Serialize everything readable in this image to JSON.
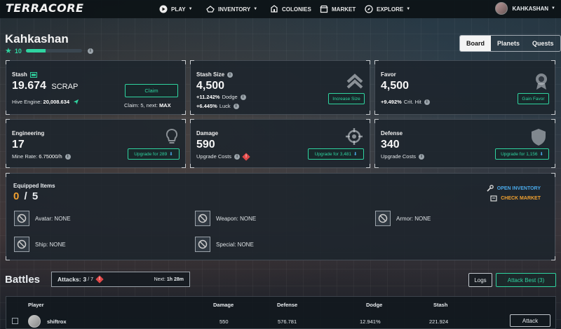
{
  "app": {
    "logo": "TERRACORE"
  },
  "nav": {
    "play": "PLAY",
    "inventory": "INVENTORY",
    "colonies": "COLONIES",
    "market": "MARKET",
    "explore": "EXPLORE",
    "username": "KAHKASHAN"
  },
  "profile": {
    "name": "Kahkashan",
    "level": "10",
    "xp_fraction": 0.35
  },
  "tabs": [
    "Board",
    "Planets",
    "Quests"
  ],
  "stash": {
    "title": "Stash",
    "value": "19.674",
    "unit": "SCRAP",
    "hive_label": "Hive Engine:",
    "hive_value": "20,008.634",
    "claim_button": "Claim",
    "claim_label": "Claim: 5, next:",
    "claim_next": "MAX"
  },
  "stash_size": {
    "title": "Stash Size",
    "value": "4,500",
    "dodge_pct": "+11.242%",
    "dodge_label": "Dodge",
    "luck_pct": "+6.445%",
    "luck_label": "Luck",
    "button": "Increase Size"
  },
  "favor": {
    "title": "Favor",
    "value": "4,500",
    "crit_pct": "+9.492%",
    "crit_label": "Crit. Hit",
    "button": "Gain Favor"
  },
  "engineering": {
    "title": "Engineering",
    "value": "17",
    "sub_label": "Mine Rate:",
    "sub_value": "6.75000/h",
    "button": "Upgrade for 289"
  },
  "damage": {
    "title": "Damage",
    "value": "590",
    "sub_label": "Upgrade Costs",
    "button": "Upgrade for 3,481"
  },
  "defense": {
    "title": "Defense",
    "value": "340",
    "sub_label": "Upgrade Costs",
    "button": "Upgrade for 1,156"
  },
  "equipped": {
    "title": "Equipped Items",
    "count": "0",
    "separator": "/",
    "total": "5",
    "open_inventory": "OPEN INVENTORY",
    "check_market": "CHECK MARKET",
    "slots": [
      "Avatar: NONE",
      "Weapon: NONE",
      "Armor: NONE",
      "Ship: NONE",
      "Special: NONE"
    ]
  },
  "battles": {
    "title": "Battles",
    "attacks_label": "Attacks:",
    "attacks_count": "3",
    "attacks_max": "/ 7",
    "next_label": "Next:",
    "next_value": "1h 28m",
    "logs_button": "Logs",
    "attack_best_button": "Attack Best (3)",
    "columns": [
      "Player",
      "Damage",
      "Defense",
      "Dodge",
      "Stash"
    ],
    "rows": [
      {
        "player": "shiftrox",
        "damage": "550",
        "defense": "576.781",
        "dodge": "12.941%",
        "stash": "221.924",
        "action": "Attack"
      }
    ]
  },
  "colors": {
    "accent": "#2fd4a0",
    "warning": "#e04848",
    "orange": "#f0a030",
    "link_blue": "#4aa8e8"
  }
}
